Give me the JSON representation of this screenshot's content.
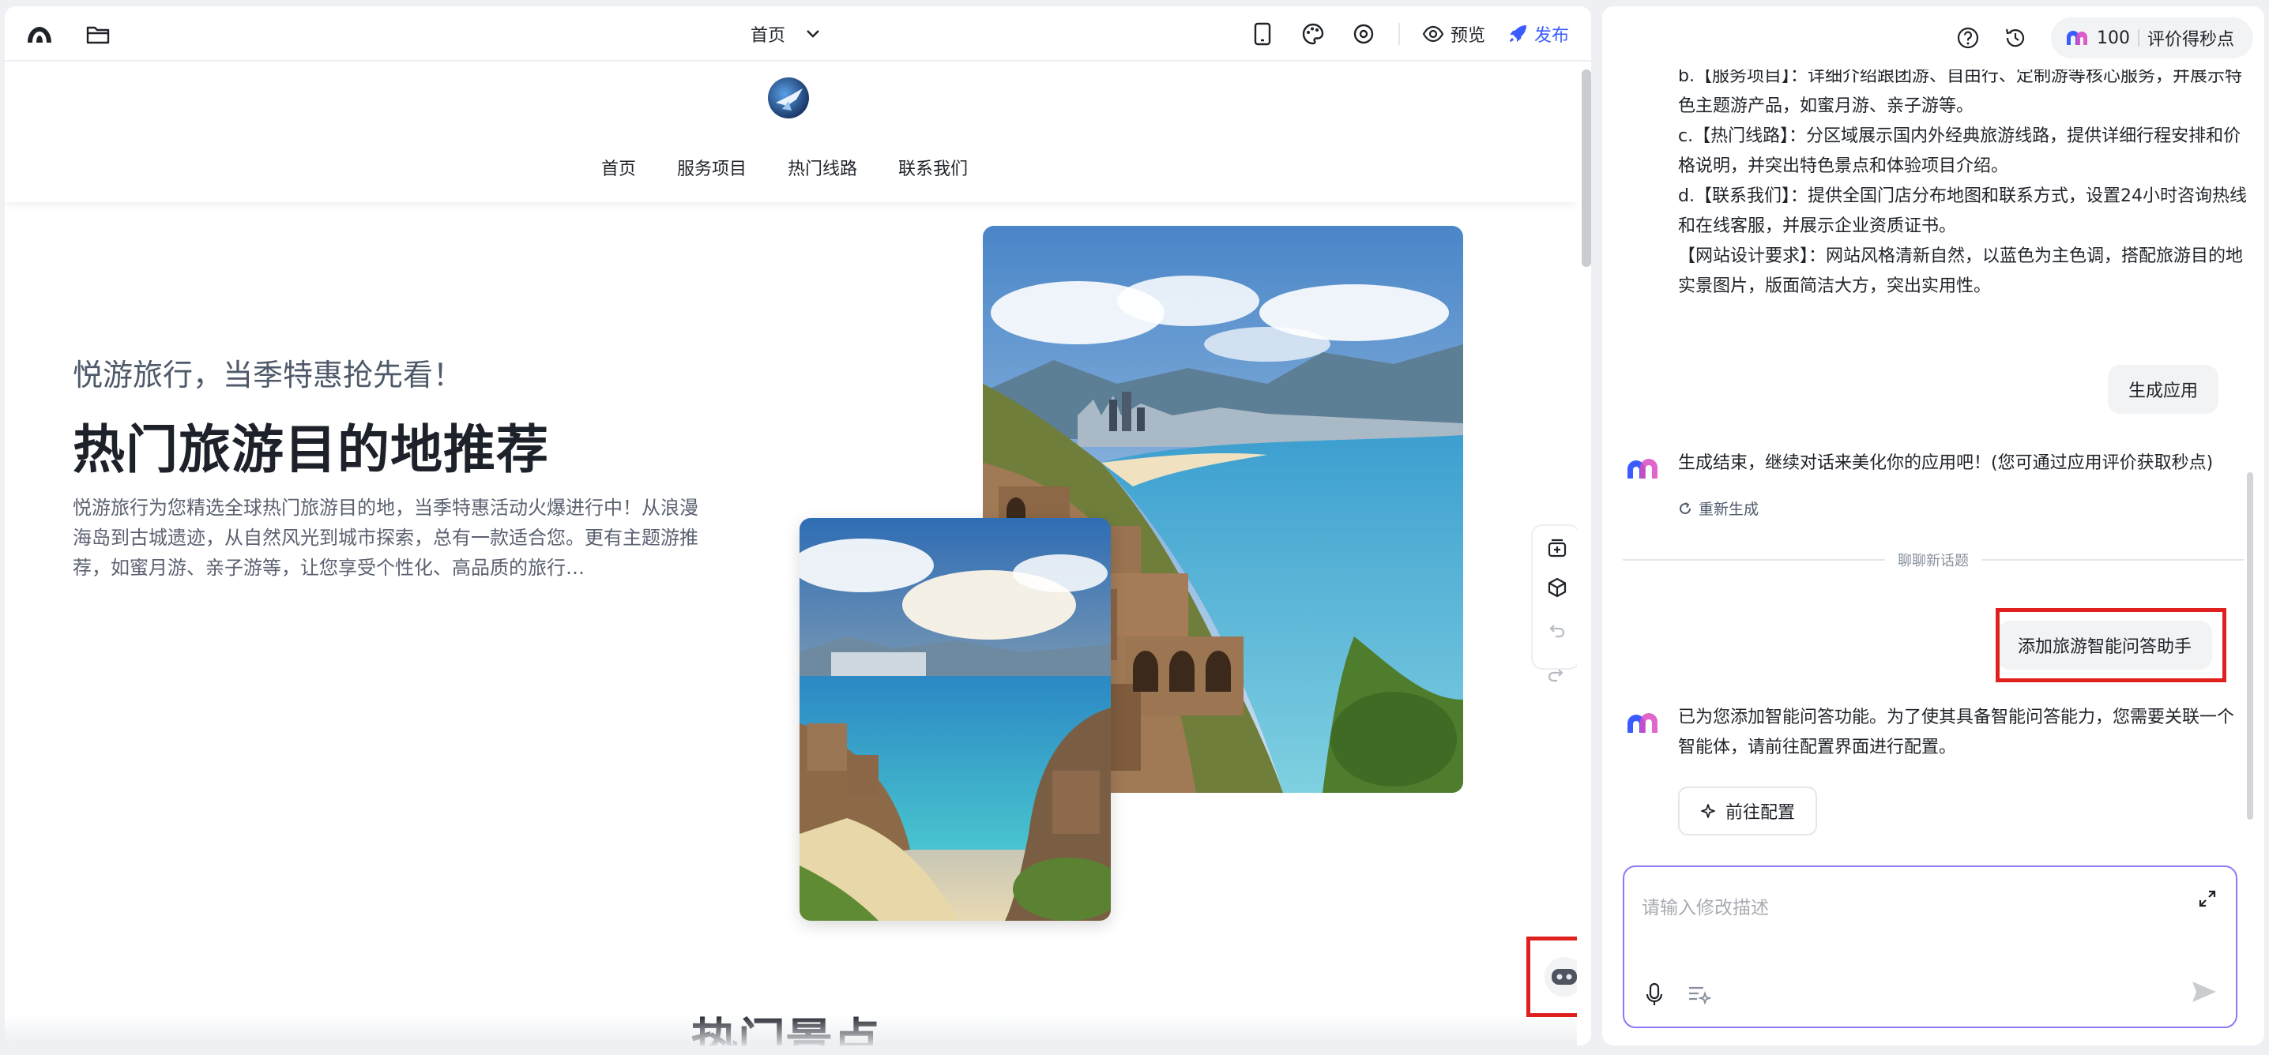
{
  "editor": {
    "page_selector": "首页",
    "preview_label": "预览",
    "publish_label": "发布"
  },
  "site": {
    "nav": [
      "首页",
      "服务项目",
      "热门线路",
      "联系我们"
    ],
    "hero_subtitle": "悦游旅行，当季特惠抢先看！",
    "hero_title": "热门旅游目的地推荐",
    "hero_desc": "悦游旅行为您精选全球热门旅游目的地，当季特惠活动火爆进行中！从浪漫海岛到古城遗迹，从自然风光到城市探索，总有一款适合您。更有主题游推荐，如蜜月游、亲子游等，让您享受个性化、高品质的旅行…",
    "section_title": "热门景点"
  },
  "assistant": {
    "points_value": "100",
    "points_label": "评价得秒点",
    "requirements": [
      "b.【服务项目】：详细介绍跟团游、自由行、定制游等核心服务，并展示特色主题游产品，如蜜月游、亲子游等。",
      "c.【热门线路】：分区域展示国内外经典旅游线路，提供详细行程安排和价格说明，并突出特色景点和体验项目介绍。",
      "d.【联系我们】：提供全国门店分布地图和联系方式，设置24小时咨询热线和在线客服，并展示企业资质证书。",
      "【网站设计要求】：网站风格清新自然，以蓝色为主色调，搭配旅游目的地实景图片，版面简洁大方，突出实用性。"
    ],
    "user_msg_1": "生成应用",
    "bot_msg_1": "生成结束，继续对话来美化你的应用吧！(您可通过应用评价获取秒点)",
    "regenerate_label": "重新生成",
    "new_topic_label": "聊聊新话题",
    "user_msg_2": "添加旅游智能问答助手",
    "bot_msg_2": "已为您添加智能问答功能。为了使其具备智能问答能力，您需要关联一个智能体，请前往配置界面进行配置。",
    "config_button": "前往配置",
    "input_placeholder": "请输入修改描述"
  },
  "colors": {
    "accent": "#3b5bff",
    "highlight_box": "#e0201e",
    "input_border": "#8a7cf5"
  }
}
